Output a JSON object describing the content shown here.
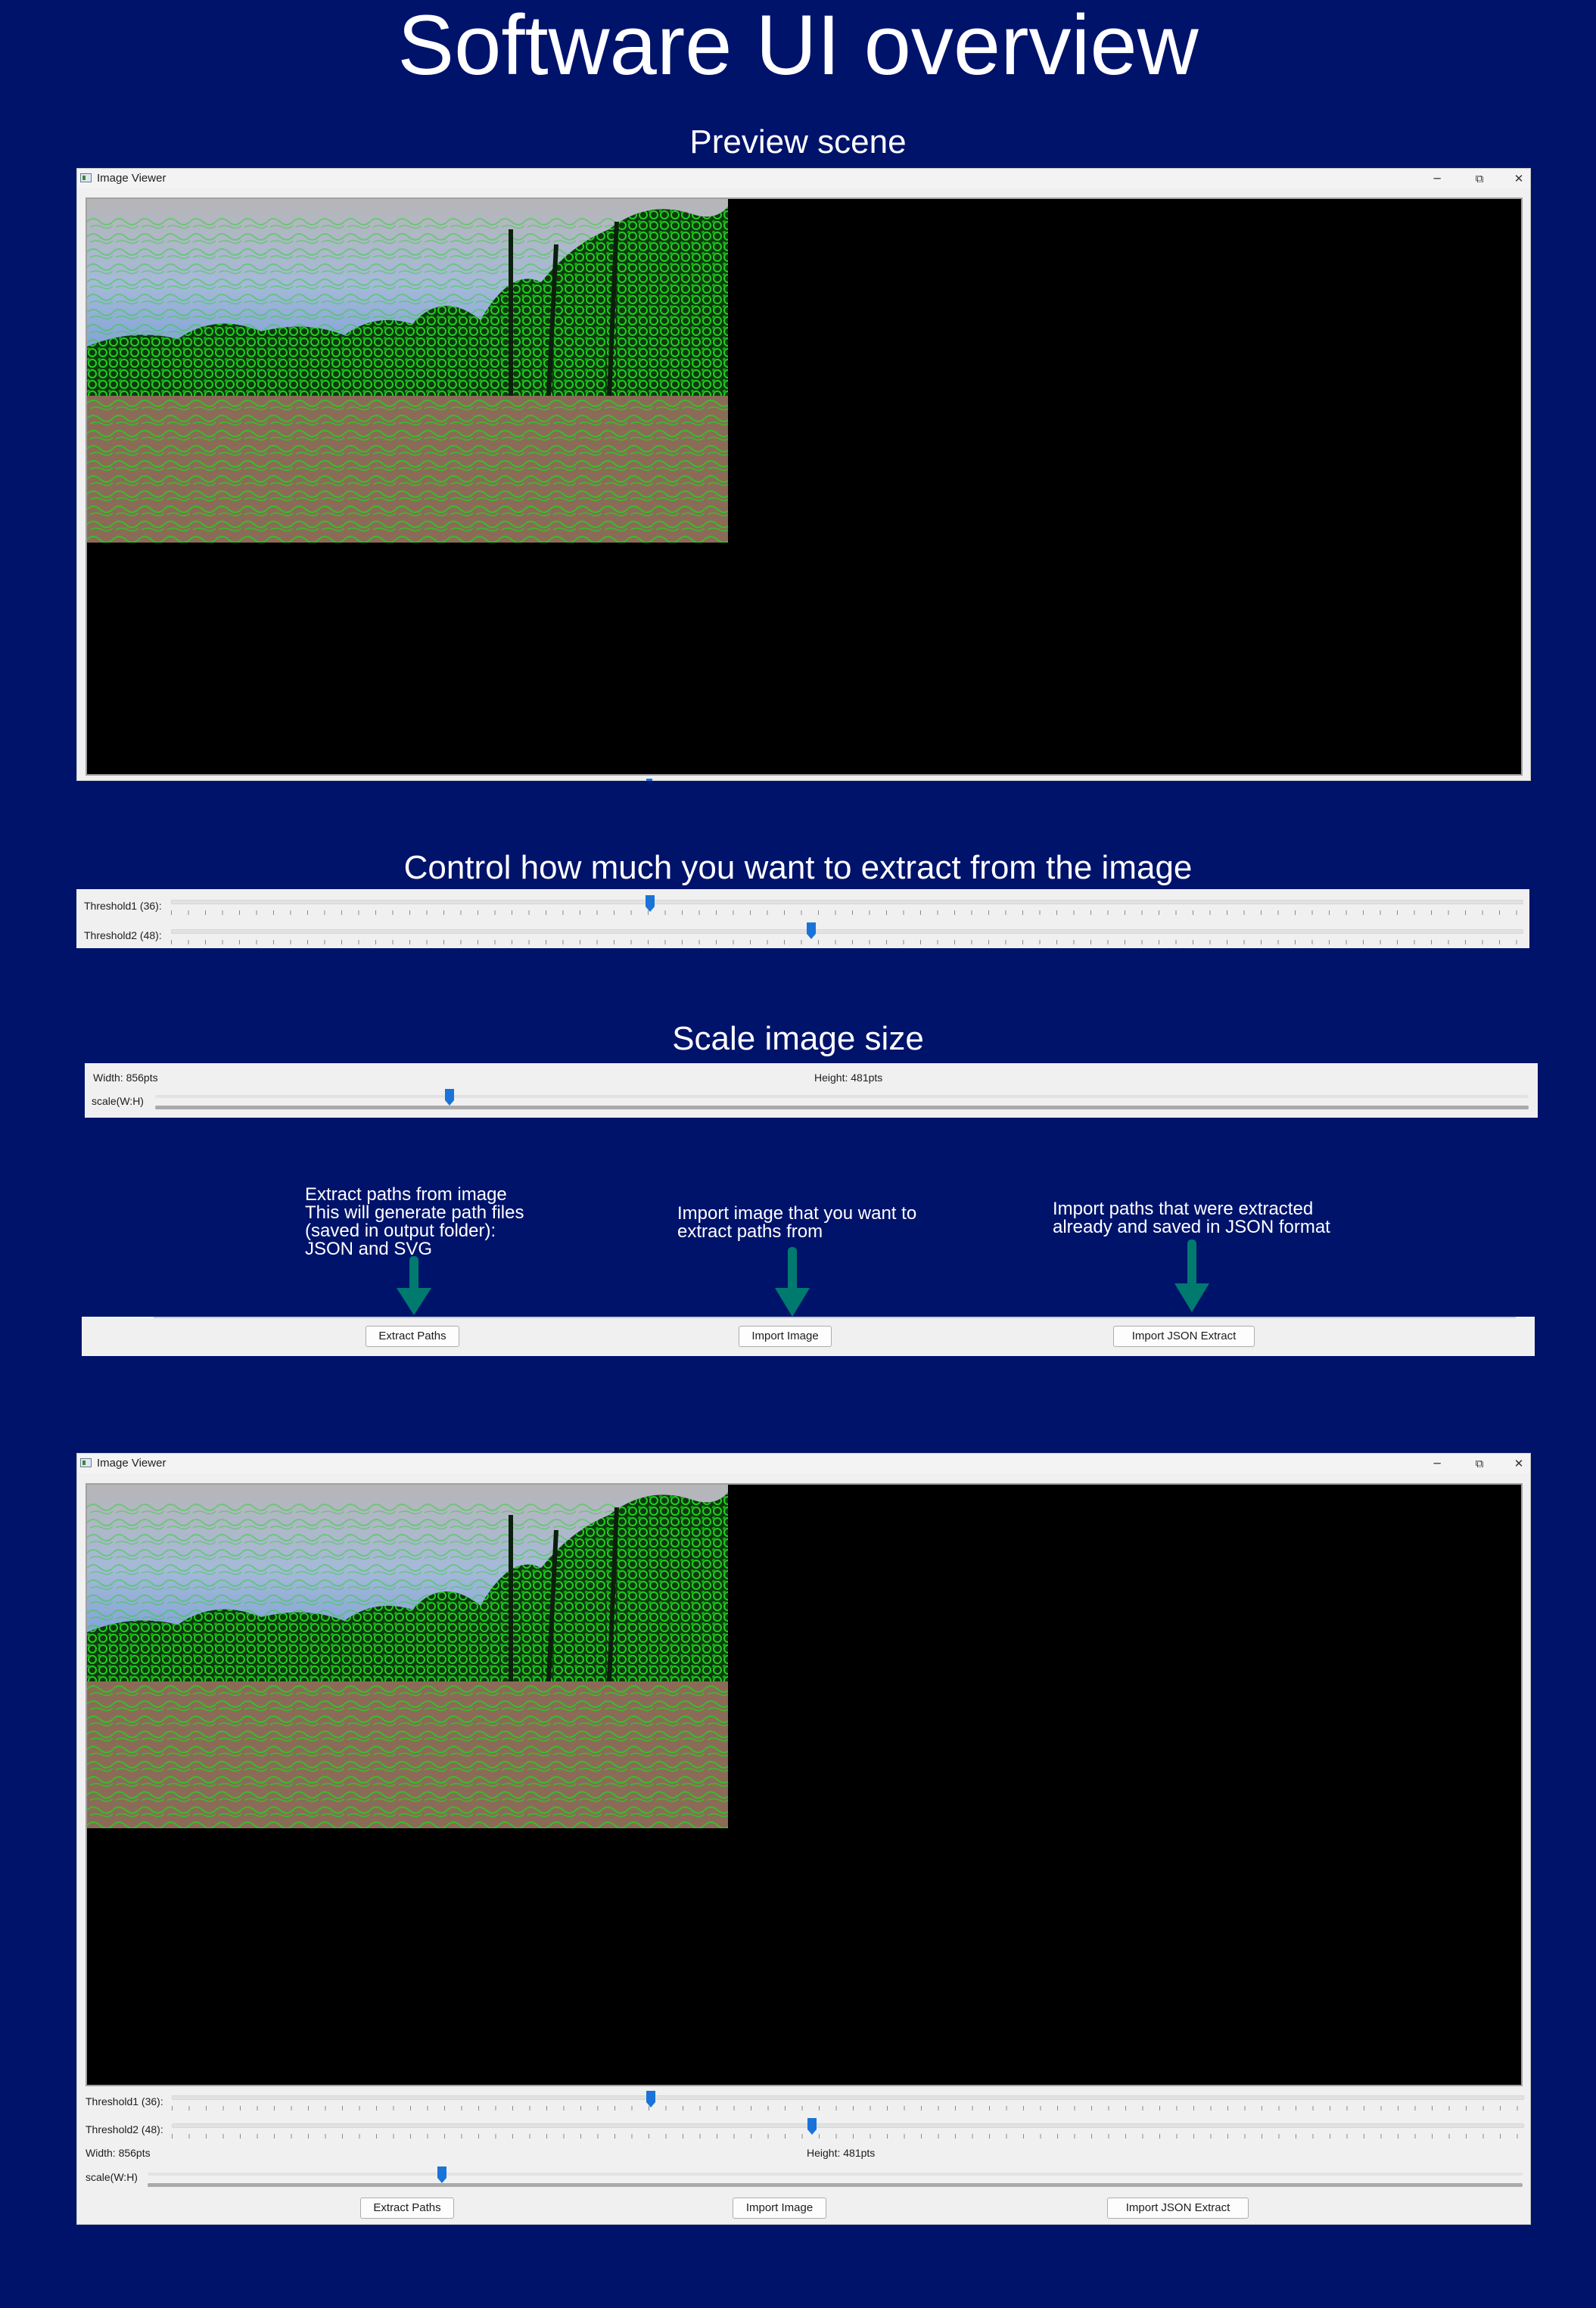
{
  "main_title": "Software UI overview",
  "sections": {
    "preview_title": "Preview scene",
    "extract_title": "Control how much you want to extract from the image",
    "scale_title": "Scale image size"
  },
  "window": {
    "title": "Image Viewer",
    "minimize_glyph": "─",
    "maximize_glyph": "⧉",
    "close_glyph": "✕"
  },
  "thresholds": {
    "t1_label": "Threshold1 (36):",
    "t1_value": 36,
    "t2_label": "Threshold2 (48):",
    "t2_value": 48
  },
  "scale": {
    "width_label": "Width: 856pts",
    "height_label": "Height: 481pts",
    "scale_label": "scale(W:H)"
  },
  "buttons": {
    "extract": "Extract Paths",
    "import_image": "Import Image",
    "import_json": "Import JSON Extract"
  },
  "annotations": {
    "extract": [
      "Extract paths from image",
      "This will generate path files",
      "(saved in output folder):",
      "JSON and SVG"
    ],
    "import_image": [
      "Import image that you want to",
      "extract paths from"
    ],
    "import_json": [
      "Import paths that were extracted",
      "already and saved in JSON format"
    ]
  },
  "colors": {
    "background": "#00136b",
    "arrow": "#007a6e",
    "slider_handle": "#1a73d9",
    "edge_green": "#1fd41f"
  },
  "icons": [
    "app-icon",
    "minimize-icon",
    "maximize-icon",
    "close-icon",
    "slider-handle-icon",
    "down-arrow-icon"
  ]
}
